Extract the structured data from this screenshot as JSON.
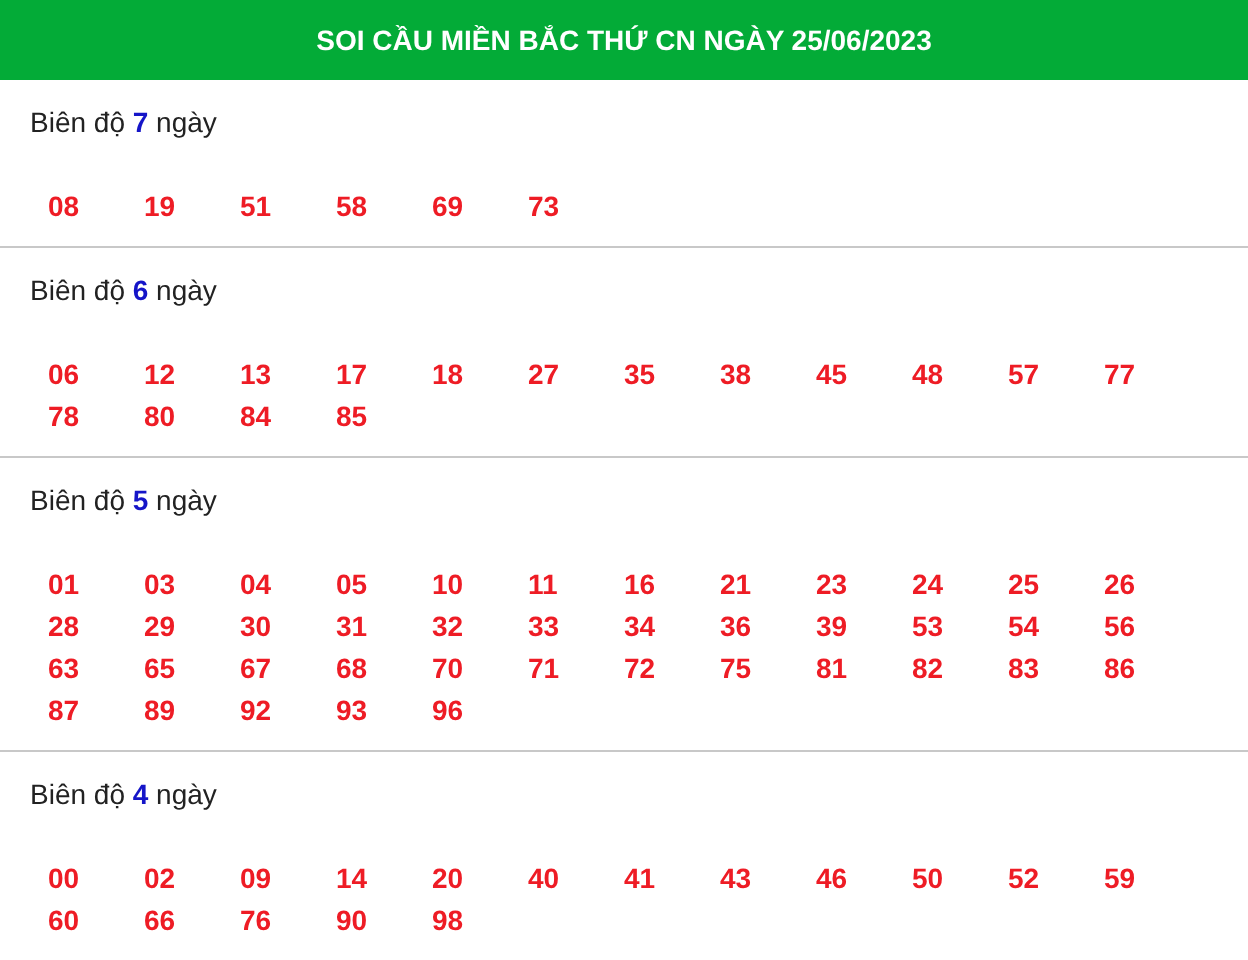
{
  "header": {
    "title": "SOI CẦU MIỀN BẮC THỨ CN NGÀY 25/06/2023"
  },
  "sections": [
    {
      "label": "Biên độ **7** ngày",
      "numbers": [
        "08",
        "19",
        "51",
        "58",
        "69",
        "73"
      ]
    },
    {
      "label": "Biên độ **6** ngày",
      "numbers": [
        "06",
        "12",
        "13",
        "17",
        "18",
        "27",
        "35",
        "38",
        "45",
        "48",
        "57",
        "77",
        "78",
        "80",
        "84",
        "85"
      ]
    },
    {
      "label": "Biên độ **5** ngày",
      "numbers": [
        "01",
        "03",
        "04",
        "05",
        "10",
        "11",
        "16",
        "21",
        "23",
        "24",
        "25",
        "26",
        "28",
        "29",
        "30",
        "31",
        "32",
        "33",
        "34",
        "36",
        "39",
        "53",
        "54",
        "56",
        "63",
        "65",
        "67",
        "68",
        "70",
        "71",
        "72",
        "75",
        "81",
        "82",
        "83",
        "86",
        "87",
        "89",
        "92",
        "93",
        "96"
      ]
    },
    {
      "label": "Biên độ **4** ngày",
      "numbers": [
        "00",
        "02",
        "09",
        "14",
        "20",
        "40",
        "41",
        "43",
        "46",
        "50",
        "52",
        "59",
        "60",
        "66",
        "76",
        "90",
        "98"
      ]
    }
  ]
}
